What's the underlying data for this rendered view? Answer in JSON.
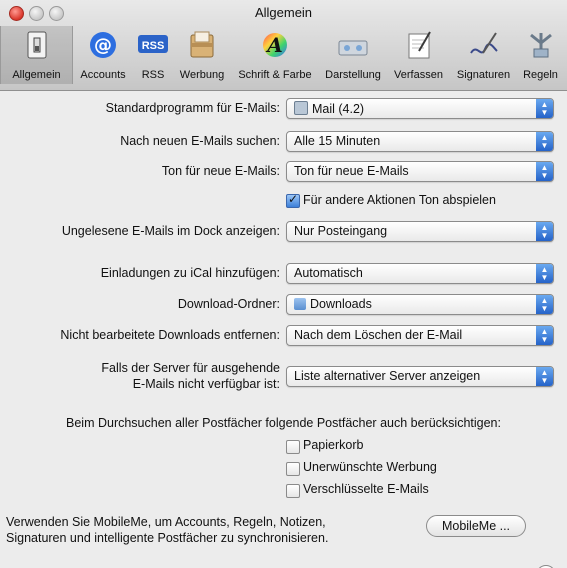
{
  "window": {
    "title": "Allgemein"
  },
  "toolbar": {
    "items": [
      {
        "label": "Allgemein",
        "icon": "switch-icon",
        "selected": true
      },
      {
        "label": "Accounts",
        "icon": "at-icon"
      },
      {
        "label": "RSS",
        "icon": "rss-icon",
        "badge": "RSS"
      },
      {
        "label": "Werbung",
        "icon": "junk-mail-icon"
      },
      {
        "label": "Schrift & Farbe",
        "icon": "font-color-icon"
      },
      {
        "label": "Darstellung",
        "icon": "viewing-icon"
      },
      {
        "label": "Verfassen",
        "icon": "compose-icon"
      },
      {
        "label": "Signaturen",
        "icon": "signature-icon"
      },
      {
        "label": "Regeln",
        "icon": "rules-icon"
      }
    ]
  },
  "settings": {
    "default_mail": {
      "label": "Standardprogramm für E-Mails:",
      "value": "Mail (4.2)"
    },
    "check_mail": {
      "label": "Nach neuen E-Mails suchen:",
      "value": "Alle 15 Minuten"
    },
    "new_mail_sound": {
      "label": "Ton für neue E-Mails:",
      "value": "Ton für neue E-Mails"
    },
    "other_sounds": {
      "label": "Für andere Aktionen Ton abspielen",
      "checked": true
    },
    "dock_unread": {
      "label": "Ungelesene E-Mails im Dock anzeigen:",
      "value": "Nur Posteingang"
    },
    "ical_invites": {
      "label": "Einladungen zu iCal hinzufügen:",
      "value": "Automatisch"
    },
    "download_folder": {
      "label": "Download-Ordner:",
      "value": "Downloads"
    },
    "remove_downloads": {
      "label": "Nicht bearbeitete Downloads entfernen:",
      "value": "Nach dem Löschen der E-Mail"
    },
    "server_unavailable": {
      "label_line1": "Falls der Server für ausgehende",
      "label_line2": "E-Mails nicht verfügbar ist:",
      "value": "Liste alternativer Server anzeigen"
    },
    "search_heading": "Beim Durchsuchen aller Postfächer folgende Postfächer auch berücksichtigen:",
    "search_boxes": [
      {
        "label": "Papierkorb",
        "checked": false
      },
      {
        "label": "Unerwünschte Werbung",
        "checked": false
      },
      {
        "label": "Verschlüsselte E-Mails",
        "checked": false
      }
    ],
    "mobileme": {
      "text_line1": "Verwenden Sie MobileMe, um Accounts, Regeln, Notizen,",
      "text_line2": "Signaturen und intelligente Postfächer zu synchronisieren.",
      "button": "MobileMe ..."
    },
    "help": "?"
  },
  "colors": {
    "accent": "#2563c9",
    "close": "#d9362b"
  }
}
